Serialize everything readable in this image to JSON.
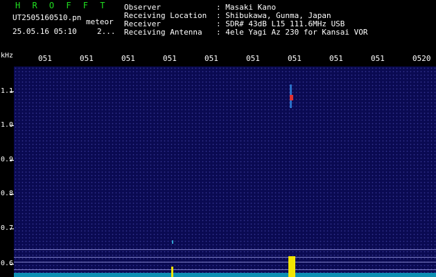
{
  "header": {
    "app_title": "H R O F F T",
    "file_name": "UT2505160510.pn",
    "meteor_label": "meteor",
    "timestamp": "25.05.16 05:10",
    "counter": "2..."
  },
  "info": {
    "observer_label": "Observer",
    "observer_value": ": Masaki Kano",
    "location_label": "Receiving Location",
    "location_value": ": Shibukawa, Gunma, Japan",
    "receiver_label": "Receiver",
    "receiver_value": ": SDR# 43dB L15 111.6MHz USB",
    "antenna_label": "Receiving Antenna",
    "antenna_value": ": 4ele Yagi Az 230 for Kansai VOR"
  },
  "axis": {
    "unit": "kHz",
    "y_ticks": [
      "1.1",
      "1.0",
      "0.9",
      "0.8",
      "0.7",
      "0.6"
    ],
    "x_ticks": [
      "051",
      "051",
      "051",
      "051",
      "051",
      "051",
      "051",
      "051",
      "051",
      "0520"
    ]
  },
  "colors": {
    "background": "#0a0a52",
    "noise": "#0c8fb3",
    "echo": "#f2e400",
    "title": "#20e020"
  }
}
